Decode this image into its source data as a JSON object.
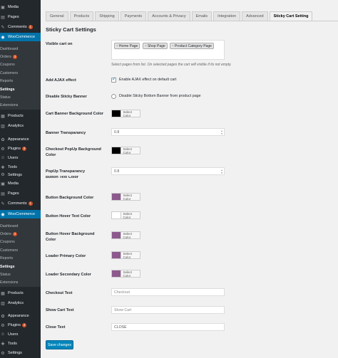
{
  "sidebar": {
    "top": [
      {
        "label": "Media",
        "icon": "media-icon"
      },
      {
        "label": "Pages",
        "icon": "pages-icon"
      },
      {
        "label": "Comments",
        "icon": "comments-icon",
        "badge": "1"
      }
    ],
    "woocommerce": {
      "label": "WooCommerce",
      "icon": "woocommerce-icon"
    },
    "woo_sub": [
      {
        "label": "Dashboard"
      },
      {
        "label": "Orders",
        "badge": "3"
      },
      {
        "label": "Coupons"
      },
      {
        "label": "Customers"
      },
      {
        "label": "Reports"
      },
      {
        "label": "Settings",
        "current": true
      },
      {
        "label": "Status"
      },
      {
        "label": "Extensions"
      }
    ],
    "bottom": [
      {
        "label": "Products",
        "icon": "products-icon"
      },
      {
        "label": "Analytics",
        "icon": "analytics-icon"
      },
      {
        "label": "Appearance",
        "icon": "appearance-icon"
      },
      {
        "label": "Plugins",
        "icon": "plugins-icon",
        "badge": "3"
      },
      {
        "label": "Users",
        "icon": "users-icon"
      },
      {
        "label": "Tools",
        "icon": "tools-icon"
      },
      {
        "label": "Settings",
        "icon": "settings-icon"
      }
    ]
  },
  "tabs": [
    "General",
    "Products",
    "Shipping",
    "Payments",
    "Accounts & Privacy",
    "Emails",
    "Integration",
    "Advanced",
    "Sticky Cart Setting"
  ],
  "active_tab": "Sticky Cart Setting",
  "section_title": "Sticky Cart Settings",
  "form": {
    "visible_cart": {
      "label": "Visible cart on",
      "chips": [
        "Home Page",
        "Shop Page",
        "Product Category Page"
      ],
      "description": "Select pages from list. On selected pages the cart will visible if its not empty."
    },
    "ajax": {
      "label": "Add AJAX effect",
      "checkbox_label": "Enable AJAX effect on default cart",
      "checked": true
    },
    "disable_banner": {
      "label": "Disable Sticky Banner",
      "checkbox_label": "Disable Sticky Bottom Banner from product page",
      "checked": false
    },
    "banner_bg": {
      "label": "Cart Banner Background Color",
      "button": "Select Color",
      "color": "#000000"
    },
    "banner_transparancy": {
      "label": "Banner Transparancy",
      "value": "0.8"
    },
    "popup_bg": {
      "label": "Checkout PopUp Background Color",
      "button": "Select Color",
      "color": "#000000"
    },
    "popup_transparancy": {
      "label": "PopUp Transparancy",
      "value": "0.8"
    },
    "button_text": {
      "label": "Button Text Color"
    },
    "button_bg": {
      "label": "Button Background Color",
      "button": "Select Color",
      "color": "#8c5a8c"
    },
    "button_hover_text": {
      "label": "Button Hover Text Color",
      "button": "Select Color",
      "color": "#ffffff"
    },
    "button_hover_bg": {
      "label": "Button Hover Background Color",
      "button": "Select Color",
      "color": "#8c5a8c"
    },
    "loader_primary": {
      "label": "Loader Primary Color",
      "button": "Select Color",
      "color": "#8c5a8c"
    },
    "loader_secondary": {
      "label": "Loader Secondary Color",
      "button": "Select Color",
      "color": "#8c5a8c"
    },
    "checkout_text": {
      "label": "Checkout Text",
      "placeholder": "Checkout"
    },
    "show_cart_text": {
      "label": "Show Cart Text",
      "placeholder": "Show Cart"
    },
    "close_text": {
      "label": "Close Text",
      "value": "CLOSE"
    }
  },
  "save_button": "Save changes"
}
